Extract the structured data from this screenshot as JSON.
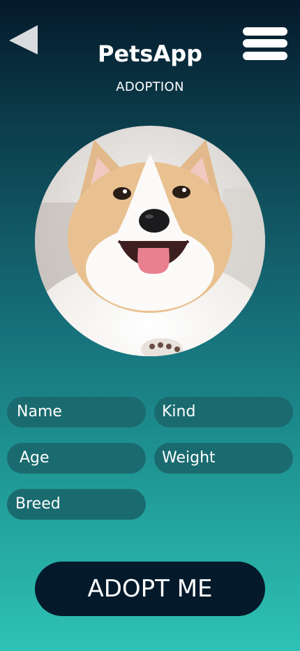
{
  "header": {
    "title": "PetsApp",
    "subtitle": "ADOPTION",
    "back_icon": "back-triangle-icon",
    "menu_icon": "hamburger-menu-icon"
  },
  "pet": {
    "photo": "pet-photo-corgi"
  },
  "form": {
    "name_placeholder": "Name",
    "kind_placeholder": "Kind",
    "age_placeholder": "Age",
    "weight_placeholder": "Weight",
    "breed_placeholder": "Breed"
  },
  "actions": {
    "adopt_label": "ADOPT ME"
  },
  "colors": {
    "background_top": "#051a2c",
    "background_bottom": "#2ec2b4",
    "field_fill": "#1a6b6f",
    "button_fill": "#041a2b",
    "text": "#ffffff"
  }
}
